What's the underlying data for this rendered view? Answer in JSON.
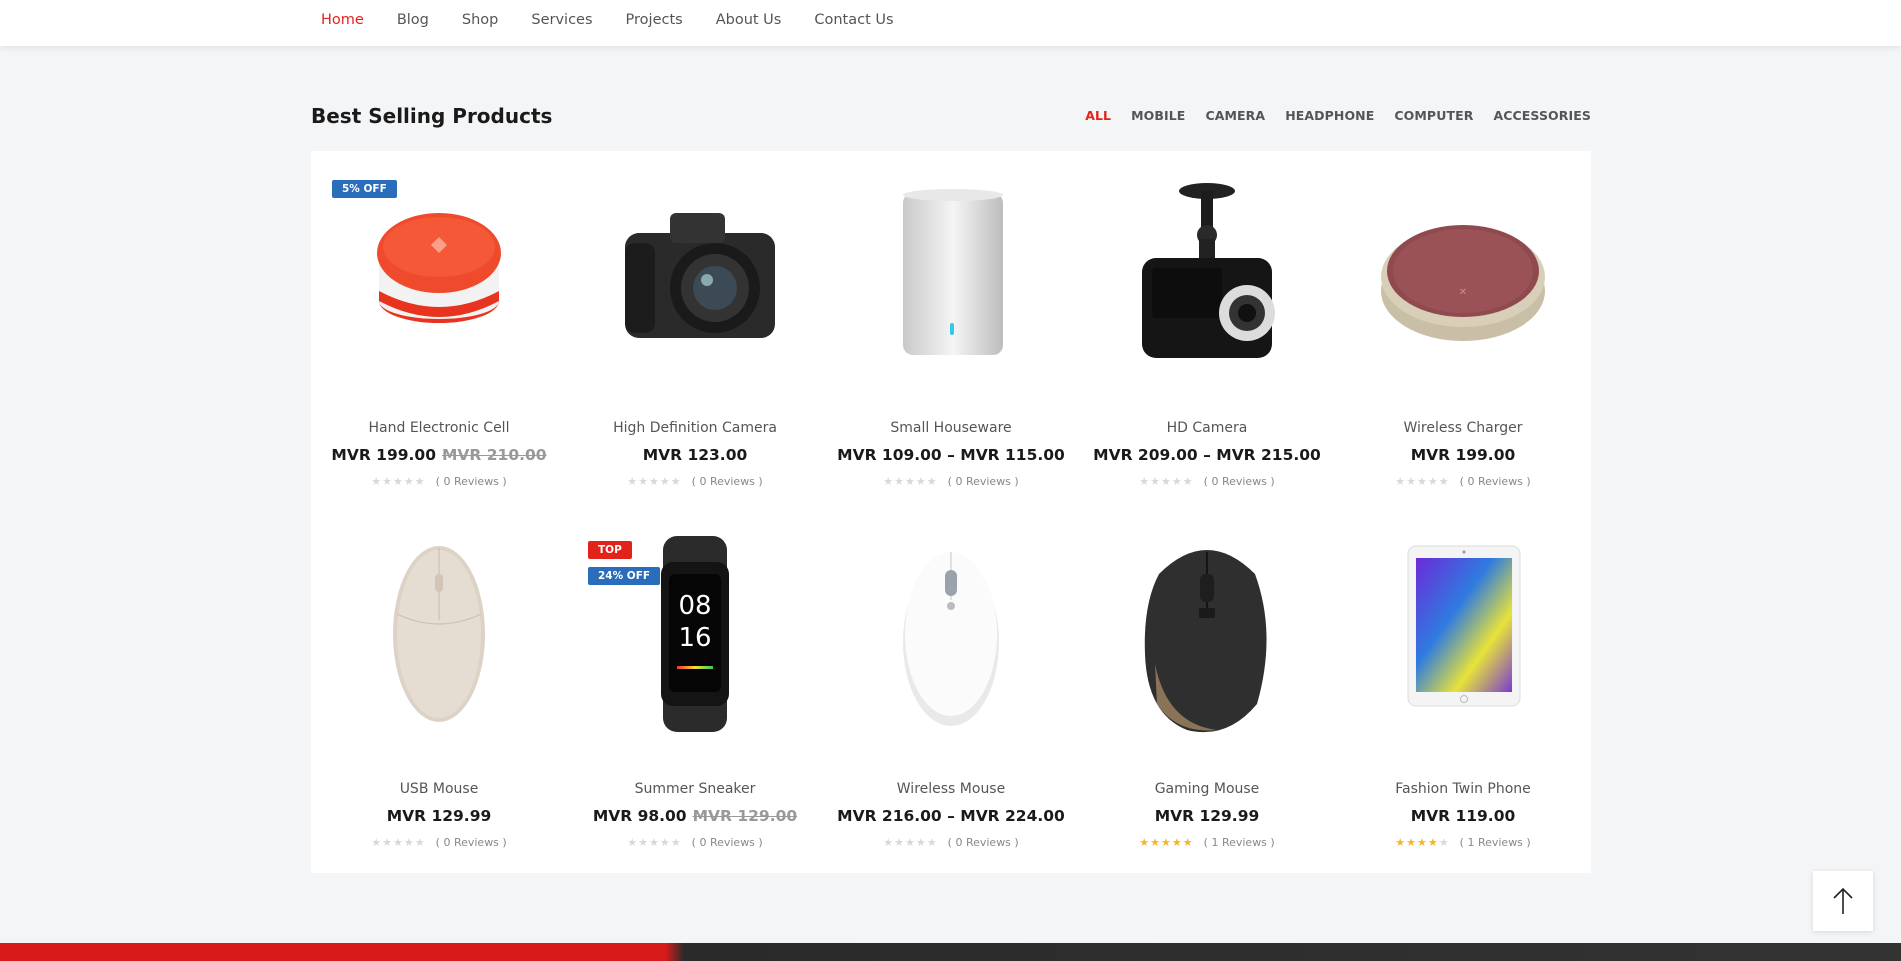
{
  "nav": {
    "items": [
      "Home",
      "Blog",
      "Shop",
      "Services",
      "Projects",
      "About Us",
      "Contact Us"
    ],
    "active": "Home"
  },
  "section": {
    "title": "Best Selling Products"
  },
  "filters": {
    "items": [
      "ALL",
      "MOBILE",
      "CAMERA",
      "HEADPHONE",
      "COMPUTER",
      "ACCESSORIES"
    ],
    "active": "ALL"
  },
  "colors": {
    "accent": "#e2231a",
    "badge_blue": "#2a6ebb",
    "star": "#f5b52e"
  },
  "products": [
    {
      "name": "Hand Electronic Cell",
      "price": "MVR 199.00",
      "old_price": "MVR 210.00",
      "badges": [
        {
          "text": "5% OFF",
          "color": "blue"
        }
      ],
      "rating": 0,
      "reviews": "( 0 Reviews )",
      "icon": "smart-speaker-icon"
    },
    {
      "name": "High Definition Camera",
      "price": "MVR 123.00",
      "old_price": "",
      "badges": [],
      "rating": 0,
      "reviews": "( 0 Reviews )",
      "icon": "dslr-camera-icon"
    },
    {
      "name": "Small Houseware",
      "price": "MVR 109.00 – MVR 115.00",
      "old_price": "",
      "badges": [],
      "rating": 0,
      "reviews": "( 0 Reviews )",
      "icon": "cylinder-speaker-icon"
    },
    {
      "name": "HD Camera",
      "price": "MVR 209.00 – MVR 215.00",
      "old_price": "",
      "badges": [],
      "rating": 0,
      "reviews": "( 0 Reviews )",
      "icon": "dash-camera-icon"
    },
    {
      "name": "Wireless Charger",
      "price": "MVR 199.00",
      "old_price": "",
      "badges": [],
      "rating": 0,
      "reviews": "( 0 Reviews )",
      "icon": "wireless-charger-icon"
    },
    {
      "name": "USB Mouse",
      "price": "MVR 129.99",
      "old_price": "",
      "badges": [],
      "rating": 0,
      "reviews": "( 0 Reviews )",
      "icon": "usb-mouse-icon"
    },
    {
      "name": "Summer Sneaker",
      "price": "MVR 98.00",
      "old_price": "MVR 129.00",
      "badges": [
        {
          "text": "TOP",
          "color": "red"
        },
        {
          "text": "24% OFF",
          "color": "blue"
        }
      ],
      "rating": 0,
      "reviews": "( 0 Reviews )",
      "icon": "fitness-band-icon",
      "band_time": [
        "08",
        "16"
      ]
    },
    {
      "name": "Wireless Mouse",
      "price": "MVR 216.00 – MVR 224.00",
      "old_price": "",
      "badges": [],
      "rating": 0,
      "reviews": "( 0 Reviews )",
      "icon": "wireless-mouse-icon"
    },
    {
      "name": "Gaming Mouse",
      "price": "MVR 129.99",
      "old_price": "",
      "badges": [],
      "rating": 5,
      "reviews": "( 1 Reviews )",
      "icon": "gaming-mouse-icon"
    },
    {
      "name": "Fashion Twin Phone",
      "price": "MVR 119.00",
      "old_price": "",
      "badges": [],
      "rating": 4,
      "reviews": "( 1 Reviews )",
      "icon": "tablet-icon"
    }
  ],
  "back_to_top": {
    "icon": "arrow-up-icon"
  }
}
